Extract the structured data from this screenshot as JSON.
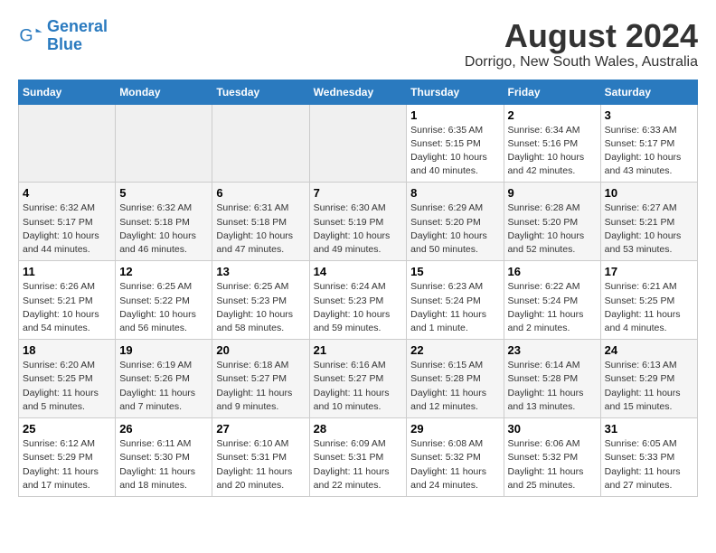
{
  "logo": {
    "line1": "General",
    "line2": "Blue",
    "icon": "🔵"
  },
  "title": "August 2024",
  "location": "Dorrigo, New South Wales, Australia",
  "weekdays": [
    "Sunday",
    "Monday",
    "Tuesday",
    "Wednesday",
    "Thursday",
    "Friday",
    "Saturday"
  ],
  "weeks": [
    [
      {
        "day": "",
        "info": ""
      },
      {
        "day": "",
        "info": ""
      },
      {
        "day": "",
        "info": ""
      },
      {
        "day": "",
        "info": ""
      },
      {
        "day": "1",
        "info": "Sunrise: 6:35 AM\nSunset: 5:15 PM\nDaylight: 10 hours\nand 40 minutes."
      },
      {
        "day": "2",
        "info": "Sunrise: 6:34 AM\nSunset: 5:16 PM\nDaylight: 10 hours\nand 42 minutes."
      },
      {
        "day": "3",
        "info": "Sunrise: 6:33 AM\nSunset: 5:17 PM\nDaylight: 10 hours\nand 43 minutes."
      }
    ],
    [
      {
        "day": "4",
        "info": "Sunrise: 6:32 AM\nSunset: 5:17 PM\nDaylight: 10 hours\nand 44 minutes."
      },
      {
        "day": "5",
        "info": "Sunrise: 6:32 AM\nSunset: 5:18 PM\nDaylight: 10 hours\nand 46 minutes."
      },
      {
        "day": "6",
        "info": "Sunrise: 6:31 AM\nSunset: 5:18 PM\nDaylight: 10 hours\nand 47 minutes."
      },
      {
        "day": "7",
        "info": "Sunrise: 6:30 AM\nSunset: 5:19 PM\nDaylight: 10 hours\nand 49 minutes."
      },
      {
        "day": "8",
        "info": "Sunrise: 6:29 AM\nSunset: 5:20 PM\nDaylight: 10 hours\nand 50 minutes."
      },
      {
        "day": "9",
        "info": "Sunrise: 6:28 AM\nSunset: 5:20 PM\nDaylight: 10 hours\nand 52 minutes."
      },
      {
        "day": "10",
        "info": "Sunrise: 6:27 AM\nSunset: 5:21 PM\nDaylight: 10 hours\nand 53 minutes."
      }
    ],
    [
      {
        "day": "11",
        "info": "Sunrise: 6:26 AM\nSunset: 5:21 PM\nDaylight: 10 hours\nand 54 minutes."
      },
      {
        "day": "12",
        "info": "Sunrise: 6:25 AM\nSunset: 5:22 PM\nDaylight: 10 hours\nand 56 minutes."
      },
      {
        "day": "13",
        "info": "Sunrise: 6:25 AM\nSunset: 5:23 PM\nDaylight: 10 hours\nand 58 minutes."
      },
      {
        "day": "14",
        "info": "Sunrise: 6:24 AM\nSunset: 5:23 PM\nDaylight: 10 hours\nand 59 minutes."
      },
      {
        "day": "15",
        "info": "Sunrise: 6:23 AM\nSunset: 5:24 PM\nDaylight: 11 hours\nand 1 minute."
      },
      {
        "day": "16",
        "info": "Sunrise: 6:22 AM\nSunset: 5:24 PM\nDaylight: 11 hours\nand 2 minutes."
      },
      {
        "day": "17",
        "info": "Sunrise: 6:21 AM\nSunset: 5:25 PM\nDaylight: 11 hours\nand 4 minutes."
      }
    ],
    [
      {
        "day": "18",
        "info": "Sunrise: 6:20 AM\nSunset: 5:25 PM\nDaylight: 11 hours\nand 5 minutes."
      },
      {
        "day": "19",
        "info": "Sunrise: 6:19 AM\nSunset: 5:26 PM\nDaylight: 11 hours\nand 7 minutes."
      },
      {
        "day": "20",
        "info": "Sunrise: 6:18 AM\nSunset: 5:27 PM\nDaylight: 11 hours\nand 9 minutes."
      },
      {
        "day": "21",
        "info": "Sunrise: 6:16 AM\nSunset: 5:27 PM\nDaylight: 11 hours\nand 10 minutes."
      },
      {
        "day": "22",
        "info": "Sunrise: 6:15 AM\nSunset: 5:28 PM\nDaylight: 11 hours\nand 12 minutes."
      },
      {
        "day": "23",
        "info": "Sunrise: 6:14 AM\nSunset: 5:28 PM\nDaylight: 11 hours\nand 13 minutes."
      },
      {
        "day": "24",
        "info": "Sunrise: 6:13 AM\nSunset: 5:29 PM\nDaylight: 11 hours\nand 15 minutes."
      }
    ],
    [
      {
        "day": "25",
        "info": "Sunrise: 6:12 AM\nSunset: 5:29 PM\nDaylight: 11 hours\nand 17 minutes."
      },
      {
        "day": "26",
        "info": "Sunrise: 6:11 AM\nSunset: 5:30 PM\nDaylight: 11 hours\nand 18 minutes."
      },
      {
        "day": "27",
        "info": "Sunrise: 6:10 AM\nSunset: 5:31 PM\nDaylight: 11 hours\nand 20 minutes."
      },
      {
        "day": "28",
        "info": "Sunrise: 6:09 AM\nSunset: 5:31 PM\nDaylight: 11 hours\nand 22 minutes."
      },
      {
        "day": "29",
        "info": "Sunrise: 6:08 AM\nSunset: 5:32 PM\nDaylight: 11 hours\nand 24 minutes."
      },
      {
        "day": "30",
        "info": "Sunrise: 6:06 AM\nSunset: 5:32 PM\nDaylight: 11 hours\nand 25 minutes."
      },
      {
        "day": "31",
        "info": "Sunrise: 6:05 AM\nSunset: 5:33 PM\nDaylight: 11 hours\nand 27 minutes."
      }
    ]
  ]
}
